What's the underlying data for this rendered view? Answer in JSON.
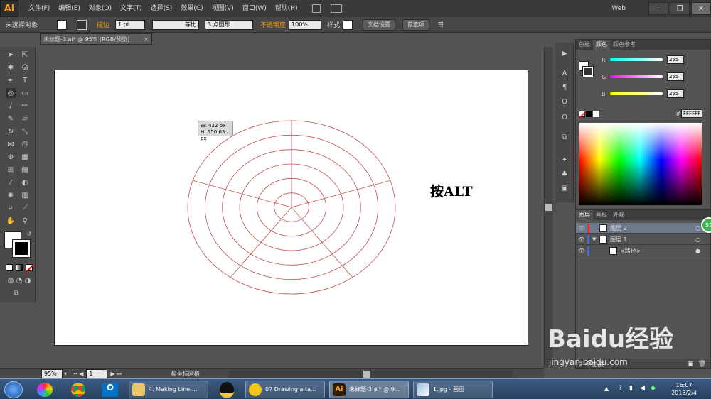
{
  "app": {
    "logo": "Ai",
    "workspace": "Web"
  },
  "menu": [
    "文件(F)",
    "编辑(E)",
    "对象(O)",
    "文字(T)",
    "选择(S)",
    "效果(C)",
    "视图(V)",
    "窗口(W)",
    "帮助(H)"
  ],
  "control": {
    "no_selection": "未选择对象",
    "stroke_label": "描边",
    "stroke_weight": "1 pt",
    "profile": "等比",
    "brush": "3 点圆形",
    "opacity_label": "不透明度",
    "opacity": "100%",
    "style_label": "样式",
    "doc_setup": "文档设置",
    "preferences": "首选项"
  },
  "document": {
    "tab": "未标题-3.ai* @ 95% (RGB/预览)",
    "tab_close": "×"
  },
  "canvas": {
    "tooltip_w": "W: 422 px",
    "tooltip_h": "H: 350.63 px",
    "annotation": "按ALT",
    "grid_color": "#c0504d"
  },
  "color_panel": {
    "tabs": [
      "色板",
      "颜色",
      "颜色参考"
    ],
    "r_label": "R",
    "r": "255",
    "g_label": "G",
    "g": "255",
    "b_label": "B",
    "b": "255",
    "hex_label": "#",
    "hex": "FFFFFF"
  },
  "layers_panel": {
    "tabs": [
      "图层",
      "画板",
      "外观"
    ],
    "rows": [
      {
        "name": "图层 2",
        "level": 0
      },
      {
        "name": "图层 1",
        "level": 0
      },
      {
        "name": "<路径>",
        "level": 1
      }
    ],
    "count": "2 个图层"
  },
  "status": {
    "zoom": "95%",
    "page": "1",
    "tool_name": "极坐标网格"
  },
  "taskbar": {
    "items": [
      "4. Making Line ...",
      "07 Drawing a ta...",
      "未标题-3.ai* @ 9...",
      "1.jpg - 画图"
    ],
    "time": "16:07",
    "date": "2018/2/4"
  },
  "watermark": {
    "text": "Baidu经验",
    "url": "jingyan.baidu.com"
  },
  "badge": "52"
}
